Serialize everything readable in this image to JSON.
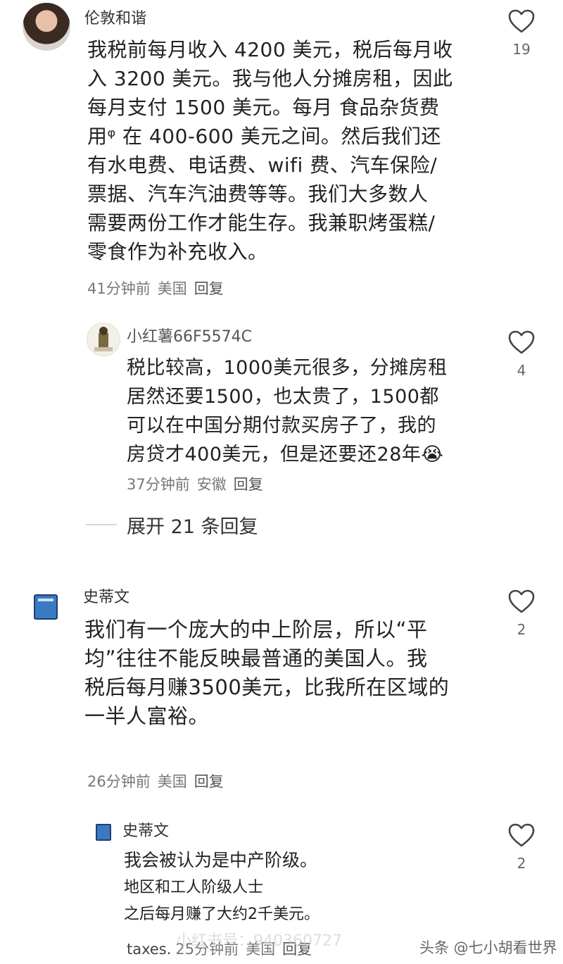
{
  "comments": [
    {
      "user": "伦敦和谐",
      "lines": [
        "我税前每月收入 4200 美元，税后每月收",
        "入 3200 美元。我与他人分摊房租，因此",
        "每月支付 1500 美元。每月 食品杂货费",
        "用ᵠ 在 400-600 美元之间。然后我们还",
        "有水电费、电话费、wifi 费、汽车保险/",
        "票据、汽车汽油费等等。我们大多数人",
        "需要两份工作才能生存。我兼职烤蛋糕/",
        "零食作为补充收入。"
      ],
      "time": "41分钟前",
      "location": "美国",
      "reply": "回复",
      "likes": "19"
    },
    {
      "user": "小红薯66F5574C",
      "lines": [
        "税比较高，1000美元很多，分摊房租",
        "居然还要1500，也太贵了，1500都",
        "可以在中国分期付款买房子了，我的",
        "房贷才400美元，但是还要还28年😭"
      ],
      "time": "37分钟前",
      "location": "安徽",
      "reply": "回复",
      "likes": "4"
    },
    {
      "user": "史蒂文",
      "lines": [
        "我们有一个庞大的中上阶层，所以“平",
        "均”往往不能反映最普通的美国人。我",
        "税后每月赚3500美元，比我所在区域的",
        "一半人富裕。"
      ],
      "time": "26分钟前",
      "location": "美国",
      "reply": "回复",
      "likes": "2"
    },
    {
      "user": "史蒂文",
      "lines": [
        "我会被认为是中产阶级。",
        "地区和工人阶级人士",
        "之后每月赚了大约2千美元。"
      ],
      "prefix": "taxes.",
      "time": "25分钟前",
      "location": "美国",
      "reply": "回复",
      "likes": "2"
    }
  ],
  "expand_replies": "展开 21 条回复",
  "watermark": "头条 @七小胡看世界",
  "faint_watermark": "小红书号：940360727",
  "icons": {
    "like": "heart-outline-icon",
    "avatar_book": "blue-book-icon"
  }
}
